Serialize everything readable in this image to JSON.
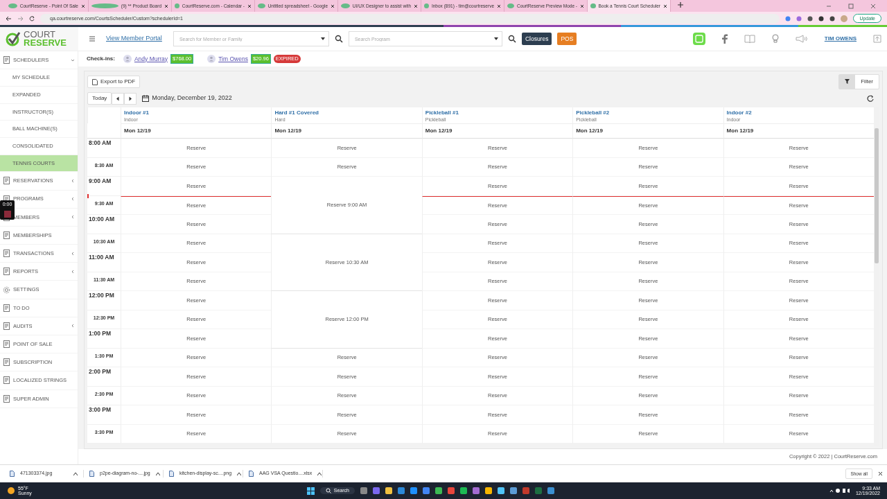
{
  "browser": {
    "tabs": [
      {
        "label": "CourtReserve - Point Of Sale",
        "selected": false
      },
      {
        "label": "(9) ** Product Board",
        "selected": false
      },
      {
        "label": "CourtReserve.com - Calendar -",
        "selected": false
      },
      {
        "label": "Untitled spreadsheet - Google",
        "selected": false
      },
      {
        "label": "UI/UX Designer to assist with",
        "selected": false
      },
      {
        "label": "Inbox (891) - tim@courtreserve",
        "selected": false
      },
      {
        "label": "CourtReserve Preview Mode -",
        "selected": false
      },
      {
        "label": "Book a Tennis Court Scheduler",
        "selected": true
      }
    ],
    "address": "qa.courtreserve.com/CourtsScheduler/Custom?schedulerId=1",
    "update_button": "Update"
  },
  "header": {
    "logo_top": "COURT",
    "logo_bottom": "RESERVE",
    "portal_link": "View Member Portal",
    "member_search": {
      "placeholder": "Search for Member or Family"
    },
    "program_search": {
      "placeholder": "Search Program"
    },
    "closures_button": "Closures",
    "pos_button": "POS",
    "user": "TIM OWENS"
  },
  "sidebar": {
    "items": [
      {
        "label": "SCHEDULERS",
        "kind": "section",
        "expanded": true,
        "children": [
          {
            "label": "MY SCHEDULE",
            "selected": false
          },
          {
            "label": "EXPANDED",
            "selected": false
          },
          {
            "label": "INSTRUCTOR(S)",
            "selected": false
          },
          {
            "label": "BALL MACHINE(S)",
            "selected": false
          },
          {
            "label": "CONSOLIDATED",
            "selected": false
          },
          {
            "label": "TENNIS COURTS",
            "selected": true
          }
        ]
      },
      {
        "label": "RESERVATIONS",
        "kind": "menu",
        "has_submenu": true
      },
      {
        "label": "PROGRAMS",
        "kind": "menu",
        "has_submenu": true
      },
      {
        "label": "MEMBERS",
        "kind": "menu",
        "has_submenu": true
      },
      {
        "label": "MEMBERSHIPS",
        "kind": "menu",
        "has_submenu": false
      },
      {
        "label": "TRANSACTIONS",
        "kind": "menu",
        "has_submenu": true
      },
      {
        "label": "REPORTS",
        "kind": "menu",
        "has_submenu": true
      },
      {
        "label": "SETTINGS",
        "kind": "menu",
        "has_submenu": false
      },
      {
        "label": "TO DO",
        "kind": "menu",
        "has_submenu": false
      },
      {
        "label": "AUDITS",
        "kind": "menu",
        "has_submenu": true
      },
      {
        "label": "POINT OF SALE",
        "kind": "menu",
        "has_submenu": false
      },
      {
        "label": "SUBSCRIPTION",
        "kind": "menu",
        "has_submenu": false
      },
      {
        "label": "LOCALIZED STRINGS",
        "kind": "menu",
        "has_submenu": false
      },
      {
        "label": "SUPER ADMIN",
        "kind": "menu",
        "has_submenu": false
      }
    ]
  },
  "recording_overlay": {
    "time": "0:00"
  },
  "checkins": {
    "label": "Check-ins:",
    "members": [
      {
        "name": "Andy Murray",
        "balance": "$768.00"
      },
      {
        "name": "Tim Owens",
        "balance": "$20.96",
        "status": "EXPIRED"
      }
    ]
  },
  "toolbar": {
    "export_button": "Export to PDF",
    "today_button": "Today",
    "date": "Monday, December 19, 2022",
    "filter_button": "Filter"
  },
  "scheduler": {
    "slots": [
      {
        "label": "8:00 AM",
        "kind": "hour",
        "now": false
      },
      {
        "label": "8:30 AM",
        "kind": "half",
        "now": false
      },
      {
        "label": "9:00 AM",
        "kind": "hour",
        "now": false
      },
      {
        "label": "9:30 AM",
        "kind": "half",
        "now": true
      },
      {
        "label": "10:00 AM",
        "kind": "hour",
        "now": false
      },
      {
        "label": "10:30 AM",
        "kind": "half",
        "now": false
      },
      {
        "label": "11:00 AM",
        "kind": "hour",
        "now": false
      },
      {
        "label": "11:30 AM",
        "kind": "half",
        "now": false
      },
      {
        "label": "12:00 PM",
        "kind": "hour",
        "now": false
      },
      {
        "label": "12:30 PM",
        "kind": "half",
        "now": false
      },
      {
        "label": "1:00 PM",
        "kind": "hour",
        "now": false
      },
      {
        "label": "1:30 PM",
        "kind": "half",
        "now": false
      },
      {
        "label": "2:00 PM",
        "kind": "hour",
        "now": false
      },
      {
        "label": "2:30 PM",
        "kind": "half",
        "now": false
      },
      {
        "label": "3:00 PM",
        "kind": "hour",
        "now": false
      },
      {
        "label": "3:30 PM",
        "kind": "half",
        "now": false
      }
    ],
    "courts": [
      {
        "name": "Indoor #1",
        "type": "Indoor",
        "date": "Mon 12/19",
        "cells": [
          {
            "kind": "slot",
            "label": "Reserve"
          },
          {
            "kind": "slot",
            "label": "Reserve"
          },
          {
            "kind": "slot",
            "label": "Reserve"
          },
          {
            "kind": "slot",
            "label": "Reserve"
          },
          {
            "kind": "slot",
            "label": "Reserve"
          },
          {
            "kind": "slot",
            "label": "Reserve"
          },
          {
            "kind": "slot",
            "label": "Reserve"
          },
          {
            "kind": "slot",
            "label": "Reserve"
          },
          {
            "kind": "slot",
            "label": "Reserve"
          },
          {
            "kind": "slot",
            "label": "Reserve"
          },
          {
            "kind": "slot",
            "label": "Reserve"
          },
          {
            "kind": "slot",
            "label": "Reserve"
          },
          {
            "kind": "slot",
            "label": "Reserve"
          },
          {
            "kind": "slot",
            "label": "Reserve"
          },
          {
            "kind": "slot",
            "label": "Reserve"
          },
          {
            "kind": "slot",
            "label": "Reserve"
          }
        ]
      },
      {
        "name": "Hard #1 Covered",
        "type": "Hard",
        "date": "Mon 12/19",
        "cells": [
          {
            "kind": "slot",
            "label": "Reserve"
          },
          {
            "kind": "slot",
            "label": "Reserve"
          },
          {
            "kind": "block",
            "label": "Reserve 9:00 AM"
          },
          {
            "kind": "continued"
          },
          {
            "kind": "continued"
          },
          {
            "kind": "block",
            "label": "Reserve 10:30 AM"
          },
          {
            "kind": "continued"
          },
          {
            "kind": "continued"
          },
          {
            "kind": "block",
            "label": "Reserve 12:00 PM"
          },
          {
            "kind": "continued"
          },
          {
            "kind": "continued"
          },
          {
            "kind": "slot",
            "label": "Reserve"
          },
          {
            "kind": "slot",
            "label": "Reserve"
          },
          {
            "kind": "slot",
            "label": "Reserve"
          },
          {
            "kind": "slot",
            "label": "Reserve"
          },
          {
            "kind": "slot",
            "label": "Reserve"
          }
        ]
      },
      {
        "name": "Pickleball #1",
        "type": "Pickleball",
        "date": "Mon 12/19",
        "cells": [
          {
            "kind": "slot",
            "label": "Reserve"
          },
          {
            "kind": "slot",
            "label": "Reserve"
          },
          {
            "kind": "slot",
            "label": "Reserve"
          },
          {
            "kind": "slot",
            "label": "Reserve"
          },
          {
            "kind": "slot",
            "label": "Reserve"
          },
          {
            "kind": "slot",
            "label": "Reserve"
          },
          {
            "kind": "slot",
            "label": "Reserve"
          },
          {
            "kind": "slot",
            "label": "Reserve"
          },
          {
            "kind": "slot",
            "label": "Reserve"
          },
          {
            "kind": "slot",
            "label": "Reserve"
          },
          {
            "kind": "slot",
            "label": "Reserve"
          },
          {
            "kind": "slot",
            "label": "Reserve"
          },
          {
            "kind": "slot",
            "label": "Reserve"
          },
          {
            "kind": "slot",
            "label": "Reserve"
          },
          {
            "kind": "slot",
            "label": "Reserve"
          },
          {
            "kind": "slot",
            "label": "Reserve"
          }
        ]
      },
      {
        "name": "Pickleball #2",
        "type": "Pickleball",
        "date": "Mon 12/19",
        "cells": [
          {
            "kind": "slot",
            "label": "Reserve"
          },
          {
            "kind": "slot",
            "label": "Reserve"
          },
          {
            "kind": "slot",
            "label": "Reserve"
          },
          {
            "kind": "slot",
            "label": "Reserve"
          },
          {
            "kind": "slot",
            "label": "Reserve"
          },
          {
            "kind": "slot",
            "label": "Reserve"
          },
          {
            "kind": "slot",
            "label": "Reserve"
          },
          {
            "kind": "slot",
            "label": "Reserve"
          },
          {
            "kind": "slot",
            "label": "Reserve"
          },
          {
            "kind": "slot",
            "label": "Reserve"
          },
          {
            "kind": "slot",
            "label": "Reserve"
          },
          {
            "kind": "slot",
            "label": "Reserve"
          },
          {
            "kind": "slot",
            "label": "Reserve"
          },
          {
            "kind": "slot",
            "label": "Reserve"
          },
          {
            "kind": "slot",
            "label": "Reserve"
          },
          {
            "kind": "slot",
            "label": "Reserve"
          }
        ]
      },
      {
        "name": "Indoor #2",
        "type": "Indoor",
        "date": "Mon 12/19",
        "cells": [
          {
            "kind": "slot",
            "label": "Reserve"
          },
          {
            "kind": "slot",
            "label": "Reserve"
          },
          {
            "kind": "slot",
            "label": "Reserve"
          },
          {
            "kind": "slot",
            "label": "Reserve"
          },
          {
            "kind": "slot",
            "label": "Reserve"
          },
          {
            "kind": "slot",
            "label": "Reserve"
          },
          {
            "kind": "slot",
            "label": "Reserve"
          },
          {
            "kind": "slot",
            "label": "Reserve"
          },
          {
            "kind": "slot",
            "label": "Reserve"
          },
          {
            "kind": "slot",
            "label": "Reserve"
          },
          {
            "kind": "slot",
            "label": "Reserve"
          },
          {
            "kind": "slot",
            "label": "Reserve"
          },
          {
            "kind": "slot",
            "label": "Reserve"
          },
          {
            "kind": "slot",
            "label": "Reserve"
          },
          {
            "kind": "slot",
            "label": "Reserve"
          },
          {
            "kind": "slot",
            "label": "Reserve"
          }
        ]
      }
    ]
  },
  "footer": "Copyright © 2022 | CourtReserve.com",
  "downloads": {
    "files": [
      "471303374.jpg",
      "p2pe-diagram-no-....jpg",
      "kitchen-display-sc....png",
      "AAG VSA Questio....xlsx"
    ],
    "show_all": "Show all"
  },
  "taskbar": {
    "temperature": "55°F",
    "weather": "Sunny",
    "search": "Search",
    "time": "9:33 AM",
    "date": "12/19/2022"
  }
}
